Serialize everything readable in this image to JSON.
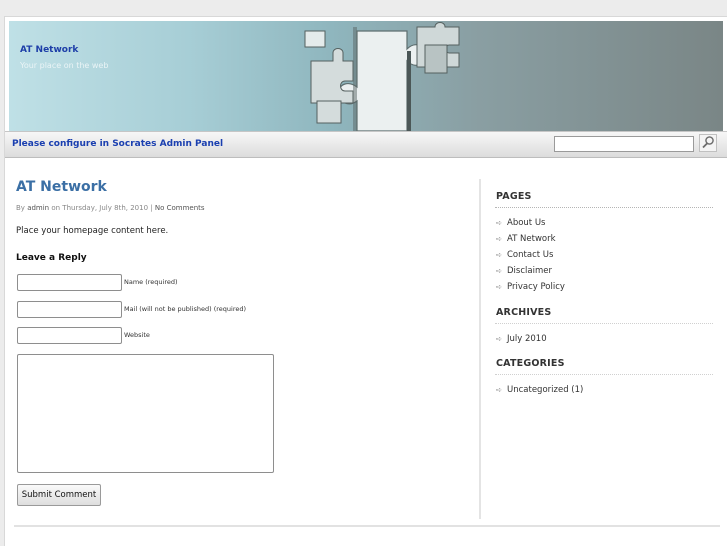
{
  "header": {
    "site_title": "AT Network",
    "tagline": "Your place on the web"
  },
  "navbar": {
    "config_link": "Please configure in Socrates Admin Panel",
    "search_value": ""
  },
  "post": {
    "title": "AT Network",
    "meta": {
      "by": "By",
      "author": "admin",
      "on": "on Thursday, July 8th, 2010 |",
      "comments": "No Comments"
    },
    "body": "Place your homepage content here."
  },
  "reply": {
    "heading": "Leave a Reply",
    "name_label": "Name (required)",
    "mail_label": "Mail (will not be published) (required)",
    "website_label": "Website",
    "submit_label": "Submit Comment"
  },
  "sidebar": {
    "pages_heading": "PAGES",
    "pages": [
      {
        "label": "About Us"
      },
      {
        "label": "AT Network"
      },
      {
        "label": "Contact Us"
      },
      {
        "label": "Disclaimer"
      },
      {
        "label": "Privacy Policy"
      }
    ],
    "archives_heading": "ARCHIVES",
    "archives": [
      {
        "label": "July 2010"
      }
    ],
    "categories_heading": "CATEGORIES",
    "categories": [
      {
        "label": "Uncategorized (1)"
      }
    ]
  },
  "colors": {
    "link_blue": "#1a3fb0",
    "title_blue": "#3b6fa5"
  }
}
